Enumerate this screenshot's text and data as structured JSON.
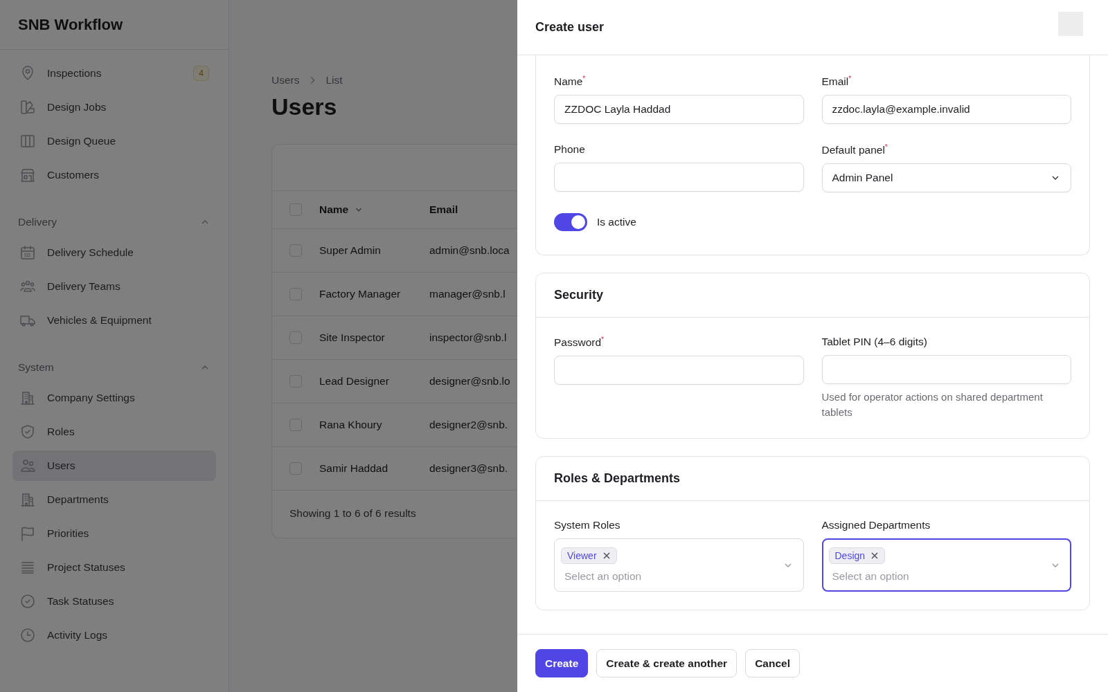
{
  "app": {
    "title": "SNB Workflow"
  },
  "sidebar": {
    "groups": [
      {
        "items": [
          {
            "label": "Inspections",
            "selected": false,
            "badge": "4"
          },
          {
            "label": "Design Jobs",
            "selected": false
          },
          {
            "label": "Design Queue",
            "selected": false
          },
          {
            "label": "Customers",
            "selected": false
          }
        ]
      },
      {
        "label": "Delivery",
        "expanded": true,
        "items": [
          {
            "label": "Delivery Schedule",
            "selected": false
          },
          {
            "label": "Delivery Teams",
            "selected": false
          },
          {
            "label": "Vehicles & Equipment",
            "selected": false
          }
        ]
      },
      {
        "label": "System",
        "expanded": true,
        "items": [
          {
            "label": "Company Settings",
            "selected": false
          },
          {
            "label": "Roles",
            "selected": false
          },
          {
            "label": "Users",
            "selected": true
          },
          {
            "label": "Departments",
            "selected": false
          },
          {
            "label": "Priorities",
            "selected": false
          },
          {
            "label": "Project Statuses",
            "selected": false
          },
          {
            "label": "Task Statuses",
            "selected": false
          },
          {
            "label": "Activity Logs",
            "selected": false
          }
        ]
      }
    ]
  },
  "page": {
    "breadcrumbs": [
      "Users",
      "List"
    ],
    "heading": "Users",
    "table": {
      "all_checked": false,
      "columns": [
        {
          "label": "Name",
          "sorted": true
        },
        {
          "label": "Email",
          "sorted": false
        }
      ],
      "rows": [
        {
          "name": "Super Admin",
          "email": "admin@snb.loca",
          "checked": false
        },
        {
          "name": "Factory Manager",
          "email": "manager@snb.l",
          "checked": false
        },
        {
          "name": "Site Inspector",
          "email": "inspector@snb.l",
          "checked": false
        },
        {
          "name": "Lead Designer",
          "email": "designer@snb.lo",
          "checked": false
        },
        {
          "name": "Rana Khoury",
          "email": "designer2@snb.",
          "checked": false
        },
        {
          "name": "Samir Haddad",
          "email": "designer3@snb.",
          "checked": false
        }
      ],
      "footer": "Showing 1 to 6 of 6 results"
    }
  },
  "modal": {
    "title": "Create user",
    "sections": [
      {
        "fields": [
          {
            "kind": "text",
            "label": "Name$^{*}$",
            "value": "ZZDOC Layla Haddad"
          },
          {
            "kind": "text",
            "label": "Email$^{*}$",
            "value": "zzdoc.layla@example.invalid"
          },
          {
            "kind": "text",
            "label": "Phone"
          },
          {
            "kind": "select",
            "label": "Default panel$^{*}$",
            "value": "Admin Panel"
          },
          {
            "kind": "toggle",
            "label": "Is active",
            "on": true
          }
        ]
      },
      {
        "title": "Security",
        "fields": [
          {
            "kind": "text",
            "label": "Password$^{*}$"
          },
          {
            "kind": "text",
            "label": "Tablet PIN (4–6 digits)",
            "helper": "Used for operator actions on shared department tablets"
          }
        ]
      },
      {
        "title": "Roles & Departments",
        "fields": [
          {
            "kind": "multiselect",
            "label": "System Roles",
            "tags": [
              "Viewer"
            ],
            "placeholder": "Select an option",
            "focused": false
          },
          {
            "kind": "multiselect",
            "label": "Assigned Departments",
            "tags": [
              "Design"
            ],
            "placeholder": "Select an option",
            "focused": true
          }
        ]
      }
    ],
    "buttons": [
      {
        "label": "Create",
        "kind": "primary"
      },
      {
        "label": "Create & create another",
        "kind": "secondary"
      },
      {
        "label": "Cancel",
        "kind": "secondary"
      }
    ]
  }
}
